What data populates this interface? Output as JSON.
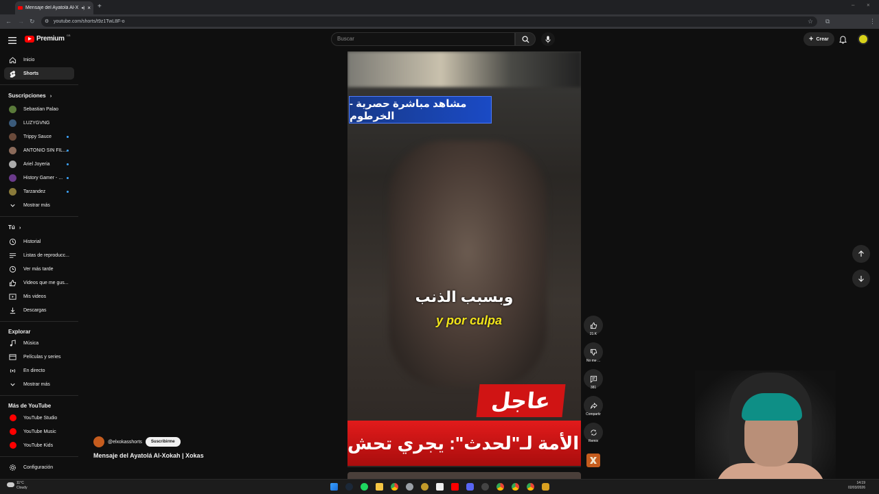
{
  "browser": {
    "tab_title": "Mensaje del Ayatolá Al-Xokah",
    "url": "youtube.com/shorts/t9z1TwL8F-o"
  },
  "header": {
    "logo_text": "Premium",
    "logo_badge": "GB",
    "search_placeholder": "Buscar",
    "create_label": "Crear"
  },
  "sidebar": {
    "top": [
      {
        "label": "Inicio",
        "icon": "home-icon"
      },
      {
        "label": "Shorts",
        "icon": "shorts-icon",
        "active": true
      }
    ],
    "subscriptions_title": "Suscripciones",
    "subscriptions": [
      {
        "label": "Sebastian Palao",
        "live": false,
        "color": "#5a7a3a"
      },
      {
        "label": "LUZYGVNG",
        "live": false,
        "color": "#3a5a7a"
      },
      {
        "label": "Trippy Sauce",
        "live": true,
        "color": "#6a4a3a"
      },
      {
        "label": "ANTONIO SIN FIL...",
        "live": true,
        "color": "#8a6a5a"
      },
      {
        "label": "Ariel Joyeria",
        "live": true,
        "color": "#aaaaaa"
      },
      {
        "label": "History Gamer - ...",
        "live": true,
        "color": "#6a3a8a"
      },
      {
        "label": "Tarzandez",
        "live": true,
        "color": "#8a7a3a"
      }
    ],
    "show_more_1": "Mostrar más",
    "you_title": "Tú",
    "you_items": [
      {
        "label": "Historial",
        "icon": "history-icon"
      },
      {
        "label": "Listas de reproducc...",
        "icon": "playlist-icon"
      },
      {
        "label": "Ver más tarde",
        "icon": "clock-icon"
      },
      {
        "label": "Videos que me gus...",
        "icon": "like-icon"
      },
      {
        "label": "Mis videos",
        "icon": "video-icon"
      },
      {
        "label": "Descargas",
        "icon": "download-icon"
      }
    ],
    "explore_title": "Explorar",
    "explore_items": [
      {
        "label": "Música",
        "icon": "music-icon"
      },
      {
        "label": "Películas y series",
        "icon": "film-icon"
      },
      {
        "label": "En directo",
        "icon": "live-icon"
      }
    ],
    "show_more_2": "Mostrar más",
    "more_title": "Más de YouTube",
    "more_items": [
      {
        "label": "YouTube Studio"
      },
      {
        "label": "YouTube Music"
      },
      {
        "label": "YouTube Kids"
      }
    ],
    "settings_label": "Configuración"
  },
  "video": {
    "banner_arabic": "مشاهد مباشرة حصرية - الخرطوم",
    "subtitle_arabic": "وبسبب الذنب",
    "subtitle_spanish": "y por culpa",
    "breaking_arabic": "عاجل",
    "ticker_arabic": "حزب الأمة لـ\"لحدث\": يجري تحش"
  },
  "actions": {
    "like_count": "21 K",
    "dislike_label": "No me ...",
    "comments_count": "381",
    "share_label": "Compartir",
    "remix_label": "Remix"
  },
  "channel": {
    "handle": "@elxokasshorts",
    "subscribe_label": "Suscribirme",
    "title": "Mensaje del Ayatolá Al-Xokah | Xokas"
  },
  "taskbar": {
    "weather_temp": "11°C",
    "weather_desc": "Cloudy",
    "time": "14:19",
    "date": "02/03/2026"
  }
}
